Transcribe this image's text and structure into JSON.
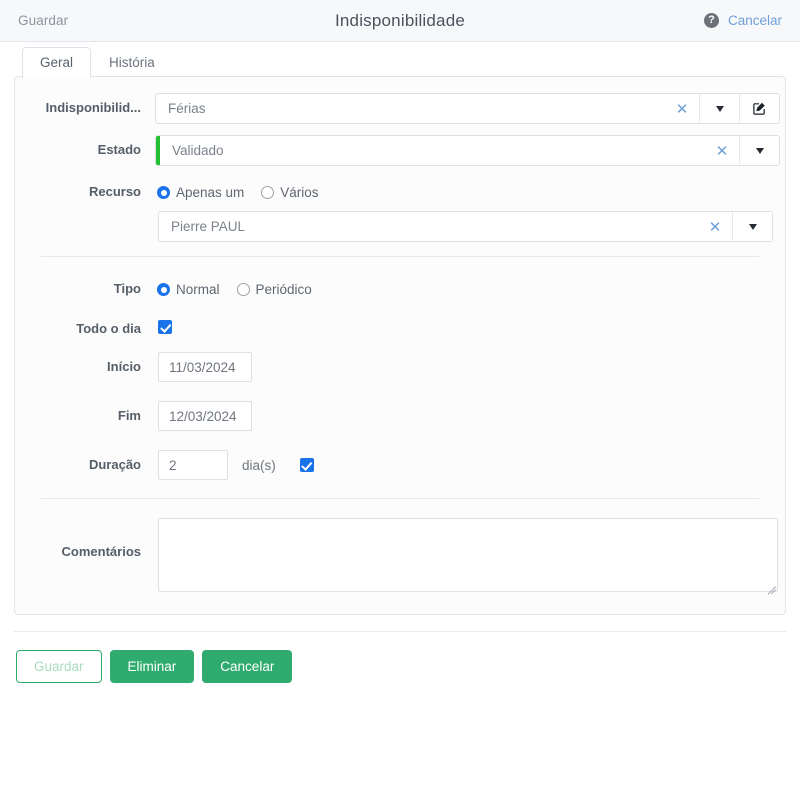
{
  "header": {
    "save_label": "Guardar",
    "title": "Indisponibilidade",
    "help_icon": "help-circle-icon",
    "cancel_label": "Cancelar"
  },
  "tabs": [
    {
      "label": "Geral",
      "active": true
    },
    {
      "label": "História",
      "active": false
    }
  ],
  "form": {
    "unavailability": {
      "label": "Indisponibilid...",
      "value": "Férias",
      "clear_icon": "close-icon",
      "dropdown_icon": "chevron-down-icon",
      "edit_icon": "edit-pencil-icon"
    },
    "state": {
      "label": "Estado",
      "value": "Validado",
      "accent_color": "#22c032",
      "clear_icon": "close-icon",
      "dropdown_icon": "chevron-down-icon"
    },
    "resource": {
      "label": "Recurso",
      "options": [
        {
          "label": "Apenas um",
          "checked": true
        },
        {
          "label": "Vários",
          "checked": false
        }
      ],
      "value": "Pierre PAUL",
      "clear_icon": "close-icon",
      "dropdown_icon": "chevron-down-icon"
    },
    "type": {
      "label": "Tipo",
      "options": [
        {
          "label": "Normal",
          "checked": true
        },
        {
          "label": "Periódico",
          "checked": false
        }
      ]
    },
    "all_day": {
      "label": "Todo o dia",
      "checked": true
    },
    "start": {
      "label": "Início",
      "value": "11/03/2024"
    },
    "end": {
      "label": "Fim",
      "value": "12/03/2024"
    },
    "duration": {
      "label": "Duração",
      "value": "2",
      "unit": "dia(s)",
      "checked": true
    },
    "comments": {
      "label": "Comentários",
      "value": "",
      "placeholder": ""
    }
  },
  "footer": {
    "save_label": "Guardar",
    "delete_label": "Eliminar",
    "cancel_label": "Cancelar"
  },
  "colors": {
    "accent_green": "#2fab6f",
    "state_green": "#22c032",
    "link_blue": "#6f9fd8",
    "control_blue": "#1a73e8"
  }
}
